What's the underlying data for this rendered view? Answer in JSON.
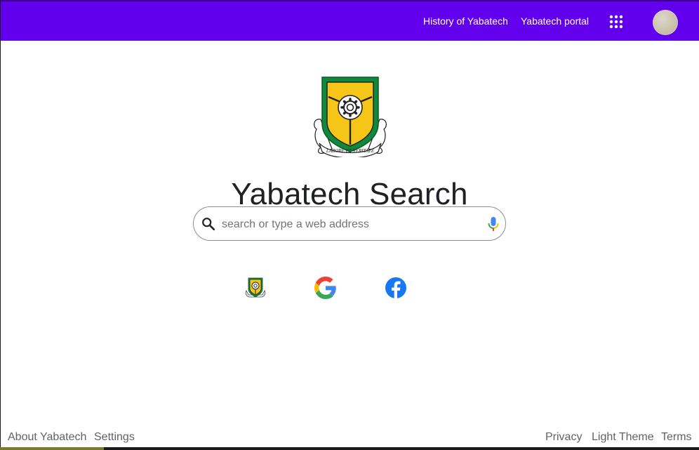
{
  "header": {
    "links": [
      "History of Yabatech",
      "Yabatech portal"
    ],
    "apps_icon": "apps-grid-icon",
    "avatar_icon": "user-avatar",
    "background_color": "#6200ee"
  },
  "main": {
    "logo": {
      "icon": "yabatech-crest-logo",
      "motto": "LABORE ET VERITATE"
    },
    "title": "Yabatech Search",
    "search": {
      "placeholder": "search or type a web address",
      "value": "",
      "search_icon": "search-icon",
      "mic_icon": "microphone-icon"
    },
    "shortcuts": [
      {
        "icon": "yabatech-crest-icon"
      },
      {
        "icon": "google-logo-icon"
      },
      {
        "icon": "facebook-logo-icon"
      }
    ]
  },
  "footer": {
    "left": [
      "About Yabatech",
      "Settings"
    ],
    "right": [
      "Privacy",
      "Light Theme",
      "Terms"
    ]
  }
}
